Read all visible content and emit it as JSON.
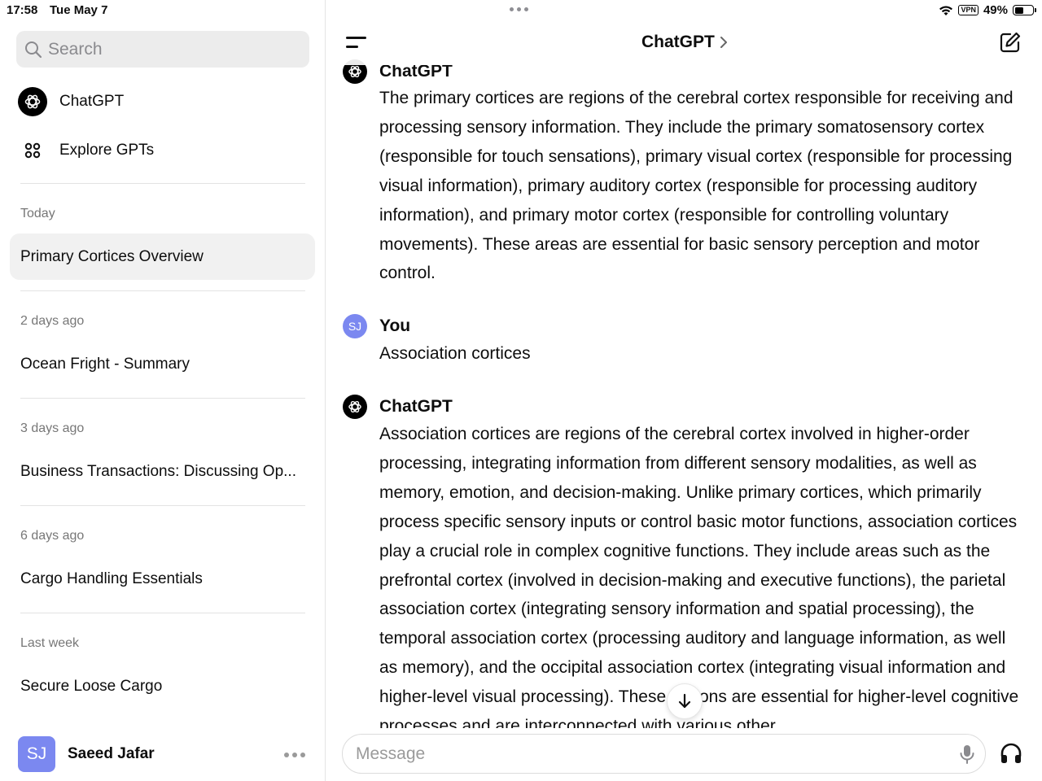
{
  "status_bar": {
    "time": "17:58",
    "date": "Tue May 7",
    "vpn": "VPN",
    "battery": "49%",
    "battery_level": 0.49
  },
  "sidebar": {
    "search_placeholder": "Search",
    "nav": [
      {
        "label": "ChatGPT",
        "icon": "chatgpt-logo-icon"
      },
      {
        "label": "Explore GPTs",
        "icon": "grid-icon"
      }
    ],
    "sections": [
      {
        "label": "Today",
        "items": [
          "Primary Cortices Overview"
        ]
      },
      {
        "label": "2 days ago",
        "items": [
          "Ocean Fright - Summary"
        ]
      },
      {
        "label": "3 days ago",
        "items": [
          "Business Transactions: Discussing Op..."
        ]
      },
      {
        "label": "6 days ago",
        "items": [
          "Cargo Handling Essentials"
        ]
      },
      {
        "label": "Last week",
        "items": [
          "Secure Loose Cargo"
        ]
      }
    ],
    "active_item": "Primary Cortices Overview",
    "user": {
      "initials": "SJ",
      "name": "Saeed Jafar"
    }
  },
  "main": {
    "title": "ChatGPT",
    "messages": [
      {
        "author": "ChatGPT",
        "role": "assistant",
        "text": "The primary cortices are regions of the cerebral cortex responsible for receiving and processing sensory information. They include the primary somatosensory cortex (responsible for touch sensations), primary visual cortex (responsible for processing visual information), primary auditory cortex (responsible for processing auditory information), and primary motor cortex (responsible for controlling voluntary movements). These areas are essential for basic sensory perception and motor control."
      },
      {
        "author": "You",
        "role": "user",
        "initials": "SJ",
        "text": "Association cortices"
      },
      {
        "author": "ChatGPT",
        "role": "assistant",
        "text": "Association cortices are regions of the cerebral cortex involved in higher-order processing, integrating information from different sensory modalities, as well as memory, emotion, and decision-making. Unlike primary cortices, which primarily process specific sensory inputs or control basic motor functions, association cortices play a crucial role in complex cognitive functions. They include areas such as the prefrontal cortex (involved in decision-making and executive functions), the parietal association cortex (integrating sensory information and spatial processing), the temporal association cortex (processing auditory and language information, as well as memory), and the occipital association cortex (integrating visual information and higher-level visual processing). These regions are essential for higher-level cognitive processes and are interconnected with various other"
      }
    ],
    "composer_placeholder": "Message"
  }
}
